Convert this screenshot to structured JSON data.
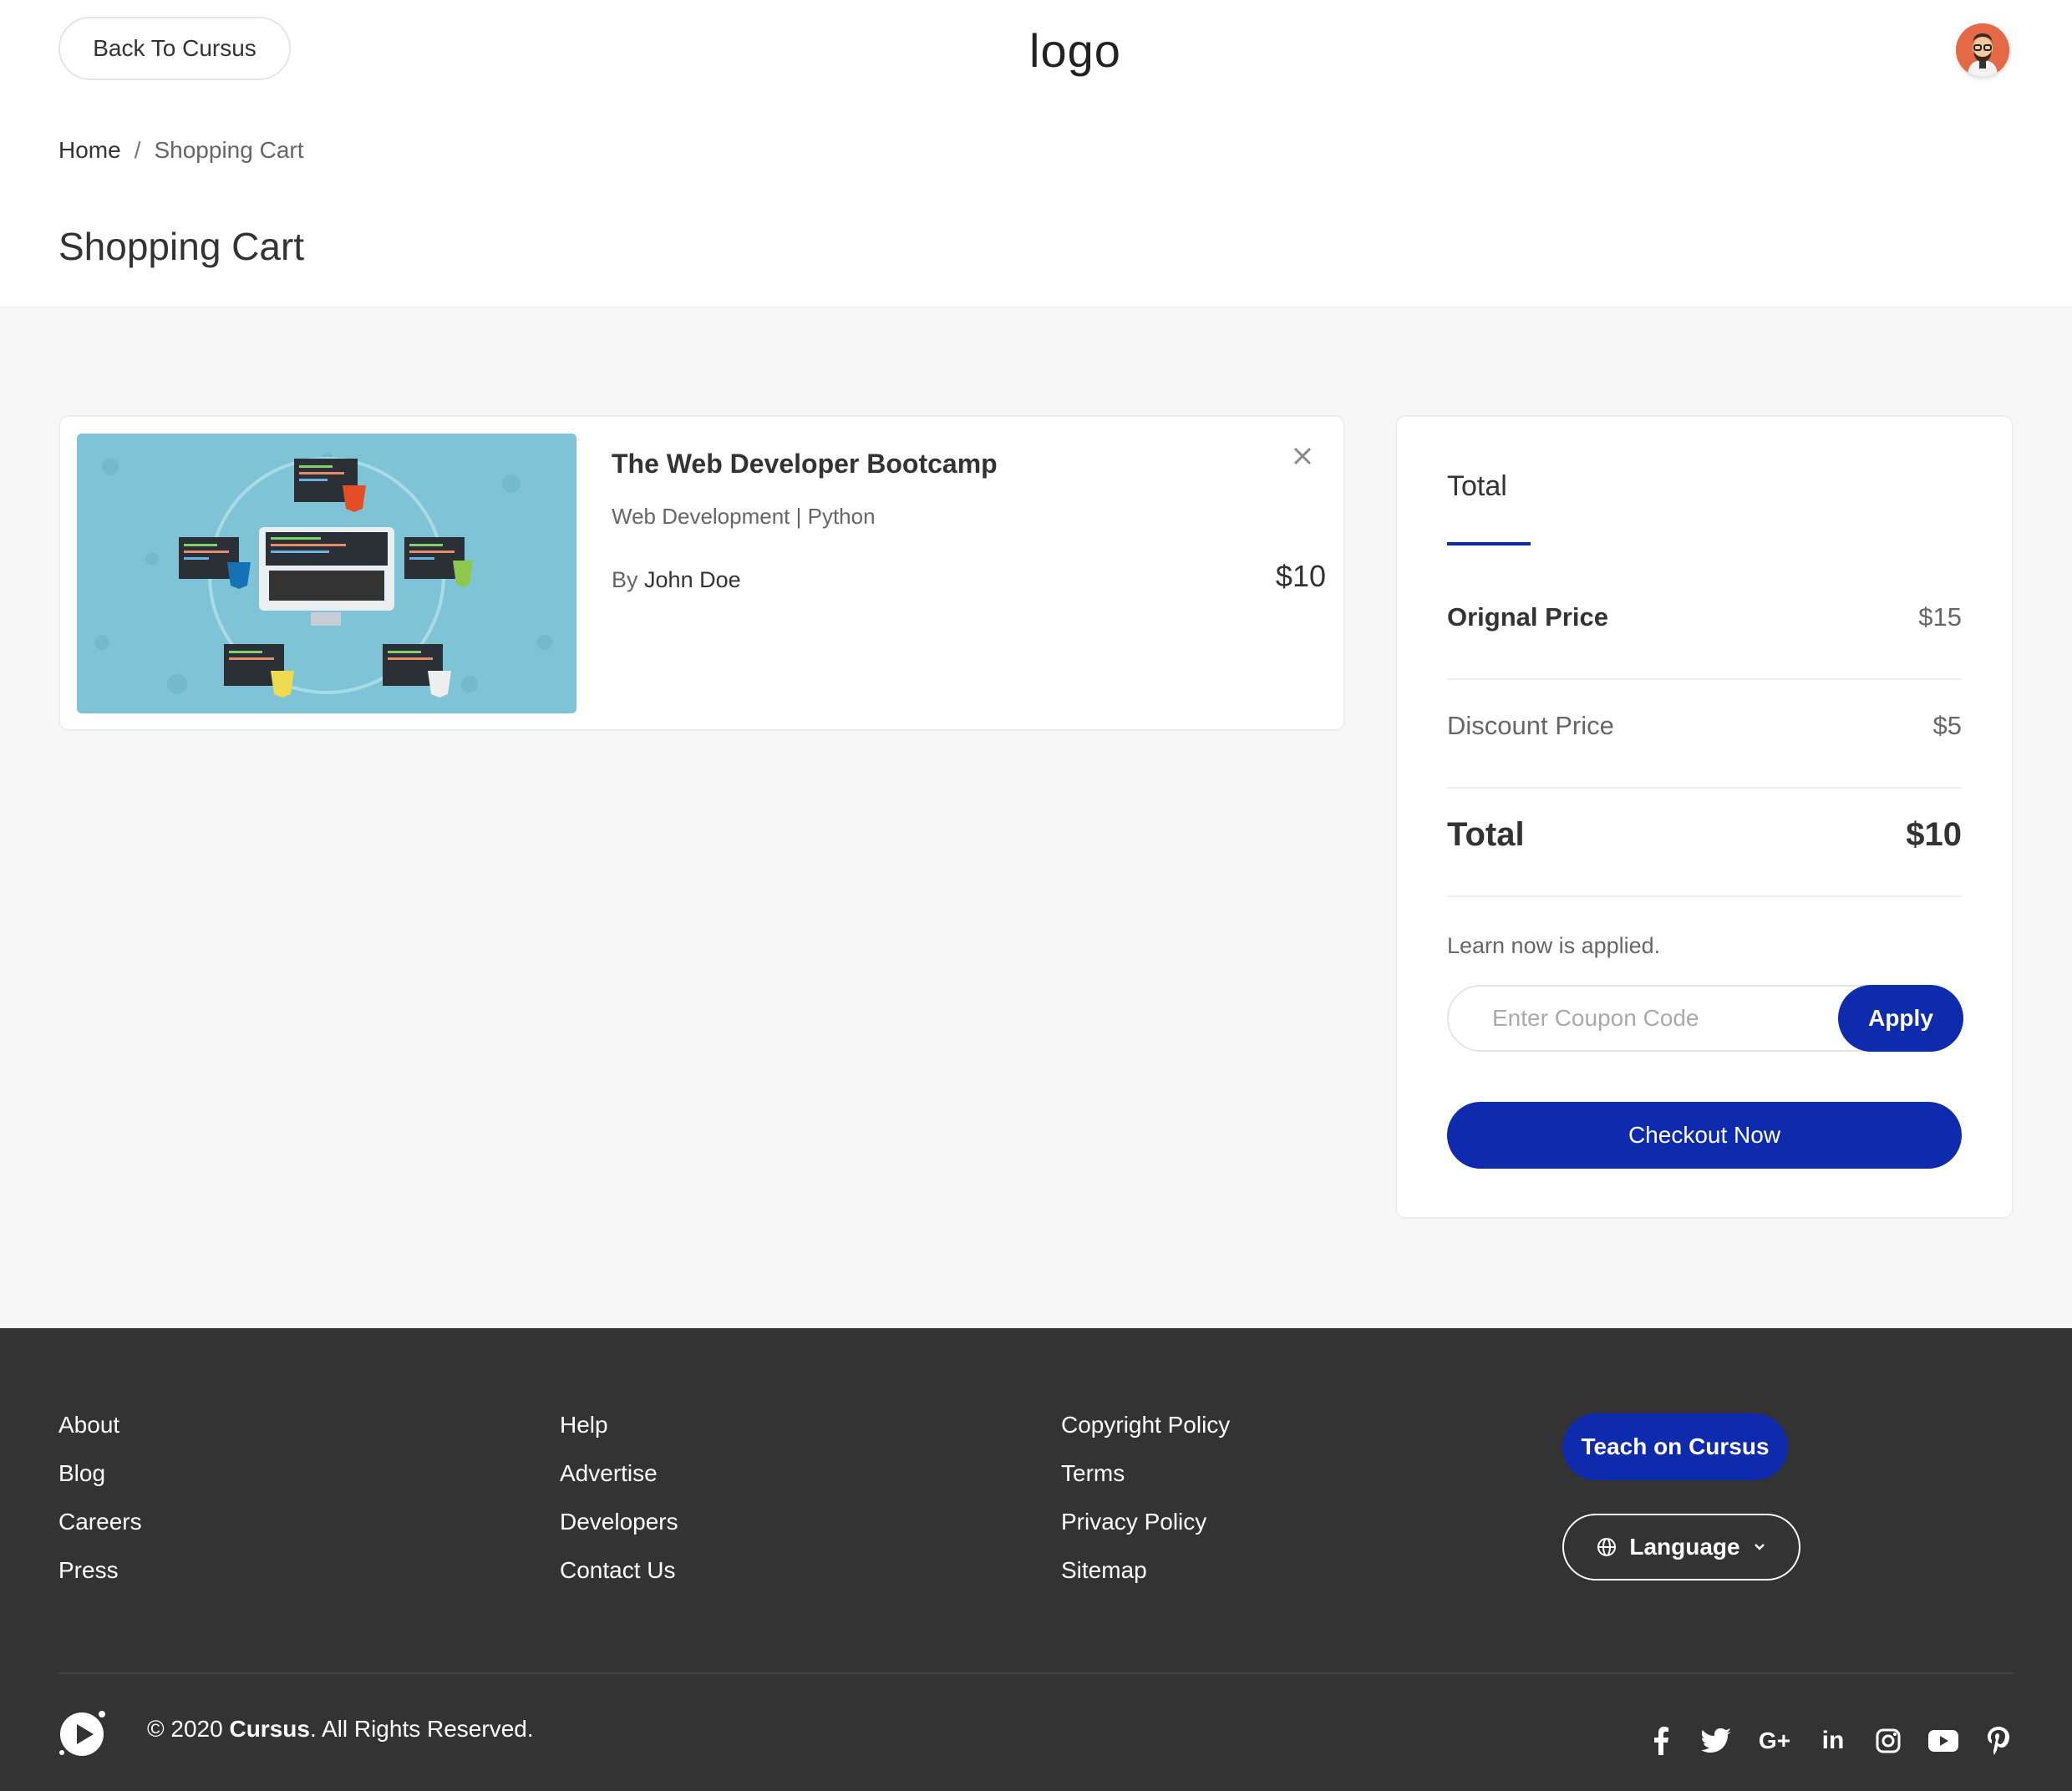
{
  "header": {
    "back_label": "Back To Cursus",
    "logo_text": "logo",
    "avatar_icon": "user-avatar-icon"
  },
  "breadcrumb": {
    "home": "Home",
    "separator": "/",
    "current": "Shopping Cart"
  },
  "page_title": "Shopping Cart",
  "cart": {
    "items": [
      {
        "title": "The Web Developer Bootcamp",
        "categories": "Web Development | Python",
        "by_label": "By",
        "author": "John Doe",
        "price": "$10"
      }
    ]
  },
  "summary": {
    "heading": "Total",
    "original_label": "Orignal Price",
    "original_value": "$15",
    "discount_label": "Discount Price",
    "discount_value": "$5",
    "total_label": "Total",
    "total_value": "$10",
    "applied_text": "Learn now is applied.",
    "coupon_placeholder": "Enter Coupon Code",
    "apply_label": "Apply",
    "checkout_label": "Checkout Now"
  },
  "footer": {
    "col1": [
      "About",
      "Blog",
      "Careers",
      "Press"
    ],
    "col2": [
      "Help",
      "Advertise",
      "Developers",
      "Contact Us"
    ],
    "col3": [
      "Copyright Policy",
      "Terms",
      "Privacy Policy",
      "Sitemap"
    ],
    "teach_label": "Teach on Cursus",
    "language_label": "Language",
    "copyright_prefix": "© 2020",
    "copyright_brand": "Cursus",
    "copyright_suffix": ". All Rights Reserved.",
    "socials": [
      "facebook-icon",
      "twitter-icon",
      "google-plus-icon",
      "linkedin-icon",
      "instagram-icon",
      "youtube-icon",
      "pinterest-icon"
    ]
  },
  "colors": {
    "accent": "#0e2aad",
    "footer_bg": "#333333",
    "page_bg": "#f7f7f7"
  }
}
